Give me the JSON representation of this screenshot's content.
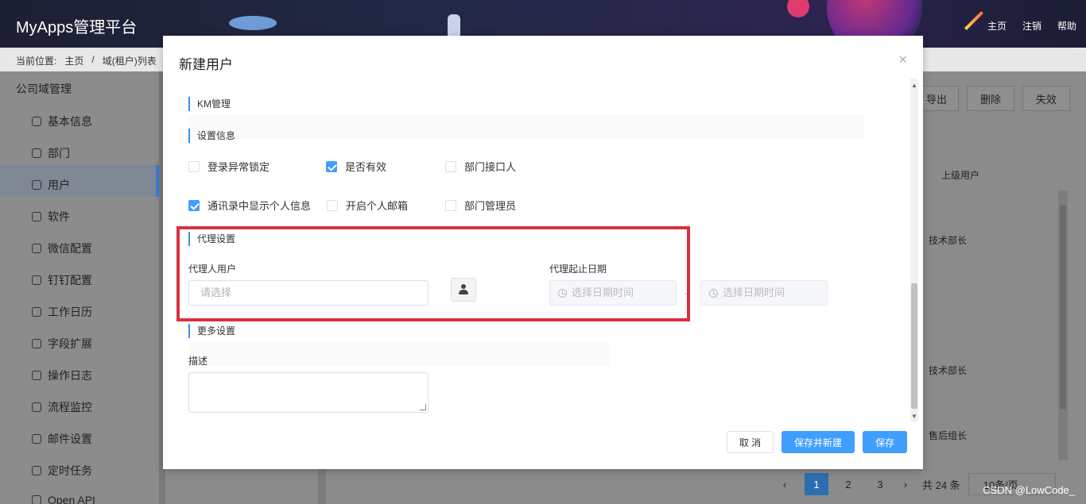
{
  "app": {
    "brand": "MyApps管理平台",
    "topnav": [
      "主页",
      "注销",
      "帮助"
    ]
  },
  "breadcrumb": {
    "label": "当前位置:",
    "home": "主页",
    "current": "域(租户)列表"
  },
  "sidebar": {
    "group": "公司域管理",
    "items": [
      {
        "label": "基本信息",
        "icon": "info-icon"
      },
      {
        "label": "部门",
        "icon": "building-icon"
      },
      {
        "label": "用户",
        "icon": "user-icon"
      },
      {
        "label": "软件",
        "icon": "cubes-icon"
      },
      {
        "label": "微信配置",
        "icon": "wechat-icon"
      },
      {
        "label": "钉钉配置",
        "icon": "plane-icon"
      },
      {
        "label": "工作日历",
        "icon": "calendar-icon"
      },
      {
        "label": "字段扩展",
        "icon": "sliders-icon"
      },
      {
        "label": "操作日志",
        "icon": "log-icon"
      },
      {
        "label": "流程监控",
        "icon": "monitor-icon"
      },
      {
        "label": "邮件设置",
        "icon": "mail-icon"
      },
      {
        "label": "定时任务",
        "icon": "clock-icon"
      },
      {
        "label": "Open API",
        "icon": "api-icon"
      }
    ]
  },
  "background_table": {
    "buttons": [
      "导出",
      "删除",
      "失效"
    ],
    "column": "上级用户",
    "cells": [
      "技术部长",
      "技术部长",
      "售后组长"
    ],
    "pager": {
      "pages": [
        "1",
        "2",
        "3"
      ],
      "total": "共 24 条",
      "size": "10条/页"
    }
  },
  "watermark": "CSDN @LowCode_",
  "modal": {
    "title": "新建用户",
    "close": "×",
    "sections": {
      "km": "KM管理",
      "settings": "设置信息",
      "proxy": "代理设置",
      "more": "更多设置"
    },
    "checkboxes": {
      "lock": {
        "label": "登录异常锁定",
        "checked": false
      },
      "valid": {
        "label": "是否有效",
        "checked": true
      },
      "dept_contact": {
        "label": "部门接口人",
        "checked": false
      },
      "show_info": {
        "label": "通讯录中显示个人信息",
        "checked": true
      },
      "mail": {
        "label": "开启个人邮箱",
        "checked": false
      },
      "dept_admin": {
        "label": "部门管理员",
        "checked": false
      }
    },
    "proxy": {
      "user_label": "代理人用户",
      "user_placeholder": "请选择",
      "date_label": "代理起止日期",
      "start_placeholder": "选择日期时间",
      "end_placeholder": "选择日期时间",
      "separator": "-"
    },
    "desc_label": "描述",
    "buttons": {
      "cancel": "取 消",
      "save_new": "保存并新建",
      "save": "保存"
    }
  }
}
